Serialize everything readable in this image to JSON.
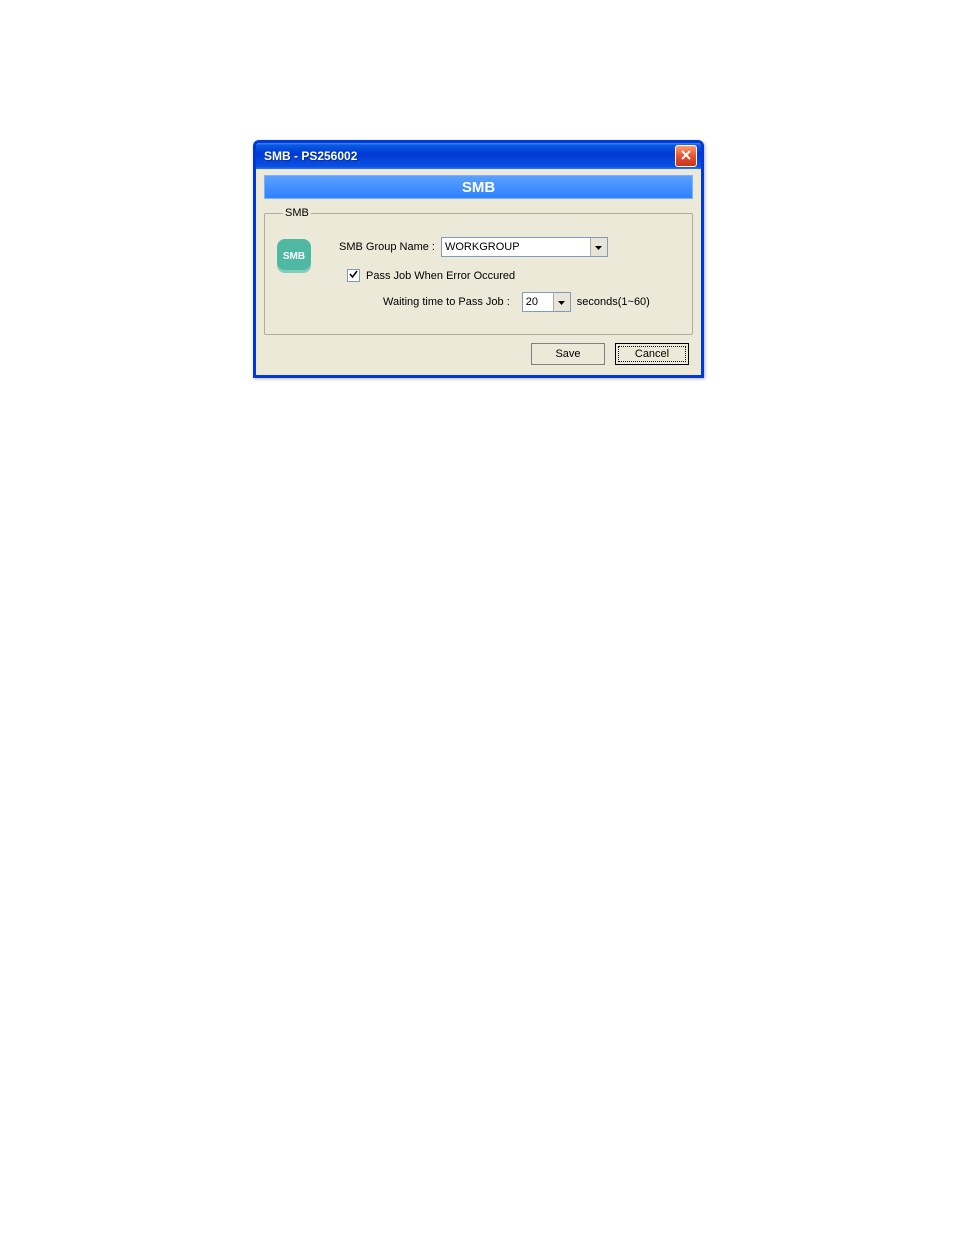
{
  "window": {
    "title": "SMB - PS256002"
  },
  "heading": "SMB",
  "group": {
    "legend": "SMB",
    "icon_text": "SMB",
    "group_name_label": "SMB Group Name :",
    "group_name_value": "WORKGROUP",
    "pass_job_label": "Pass Job When Error Occured",
    "pass_job_checked": true,
    "wait_label": "Waiting time to Pass Job :",
    "wait_value": "20",
    "wait_suffix": "seconds(1~60)"
  },
  "buttons": {
    "save": "Save",
    "cancel": "Cancel"
  }
}
